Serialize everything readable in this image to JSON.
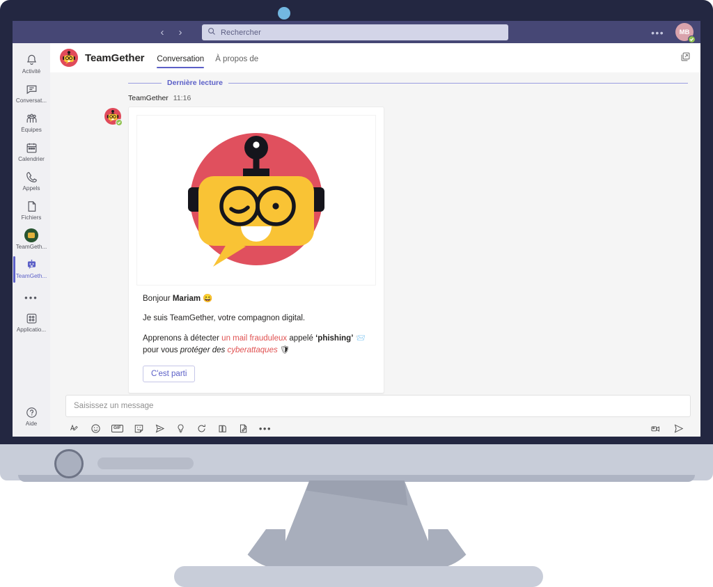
{
  "window": {
    "titlebar": {
      "back_label": "‹",
      "forward_label": "›",
      "search_placeholder": "Rechercher",
      "search_icon": "search-icon",
      "more_label": "•••",
      "avatar_initials": "MB",
      "presence": "available"
    }
  },
  "rail": {
    "items": [
      {
        "label": "Activité",
        "icon": "bell-icon"
      },
      {
        "label": "Conversat...",
        "icon": "chat-icon"
      },
      {
        "label": "Équipes",
        "icon": "teams-icon"
      },
      {
        "label": "Calendrier",
        "icon": "calendar-icon"
      },
      {
        "label": "Appels",
        "icon": "phone-icon"
      },
      {
        "label": "Fichiers",
        "icon": "file-icon"
      },
      {
        "label": "TeamGeth...",
        "icon": "team-avatar-icon"
      },
      {
        "label": "TeamGeth...",
        "icon": "bot-icon"
      }
    ],
    "more_label": "•••",
    "apps": {
      "label": "Applicatio...",
      "icon": "apps-grid-icon"
    },
    "help": {
      "label": "Aide",
      "icon": "help-circle-icon"
    }
  },
  "channel": {
    "title": "TeamGether",
    "avatar_icon": "teamgether-bot-avatar",
    "tabs": [
      {
        "label": "Conversation",
        "active": true
      },
      {
        "label": "À propos de",
        "active": false
      }
    ],
    "popout_icon": "pop-out-icon"
  },
  "conversation": {
    "unread_divider": "Dernière lecture",
    "message": {
      "author": "TeamGether",
      "time": "11:16",
      "avatar_icon": "teamgether-bot-avatar",
      "presence": "available",
      "card": {
        "hero_icon": "teamgether-robot-illustration",
        "greeting_prefix": "Bonjour ",
        "greeting_name": "Mariam",
        "greeting_emoji": "😄",
        "line2": "Je suis TeamGether, votre compagnon digital.",
        "line3_a": "Apprenons à détecter ",
        "line3_link": "un mail frauduleux",
        "line3_b": " appelé ",
        "line3_bold": "‘phishing’",
        "line3_emoji": "📨",
        "line3_c": " pour vous ",
        "line3_italic": "protéger des ",
        "line3_italic_red": "cyberattaques",
        "line3_emoji2": "🛡",
        "cta_label": "C'est parti"
      }
    }
  },
  "composer": {
    "placeholder": "Saisissez un message",
    "tools": [
      {
        "name": "format-text-icon",
        "label": "A"
      },
      {
        "name": "emoji-icon",
        "label": ""
      },
      {
        "name": "gif-icon",
        "label": "GIF"
      },
      {
        "name": "sticker-icon",
        "label": ""
      },
      {
        "name": "send-plane-icon",
        "label": ""
      },
      {
        "name": "praise-icon",
        "label": ""
      },
      {
        "name": "loop-icon",
        "label": ""
      },
      {
        "name": "approvals-icon",
        "label": ""
      },
      {
        "name": "forms-icon",
        "label": ""
      },
      {
        "name": "more-options-icon",
        "label": "•••"
      }
    ],
    "right_tools": [
      {
        "name": "video-clip-icon"
      },
      {
        "name": "send-icon"
      }
    ]
  },
  "colors": {
    "teams_purple": "#464775",
    "accent_purple": "#5b5fc7",
    "robot_red": "#e04a5a",
    "robot_yellow": "#f9c335",
    "presence_green": "#92c353",
    "monitor_dark": "#232741",
    "monitor_grey": "#c8cdd9"
  }
}
